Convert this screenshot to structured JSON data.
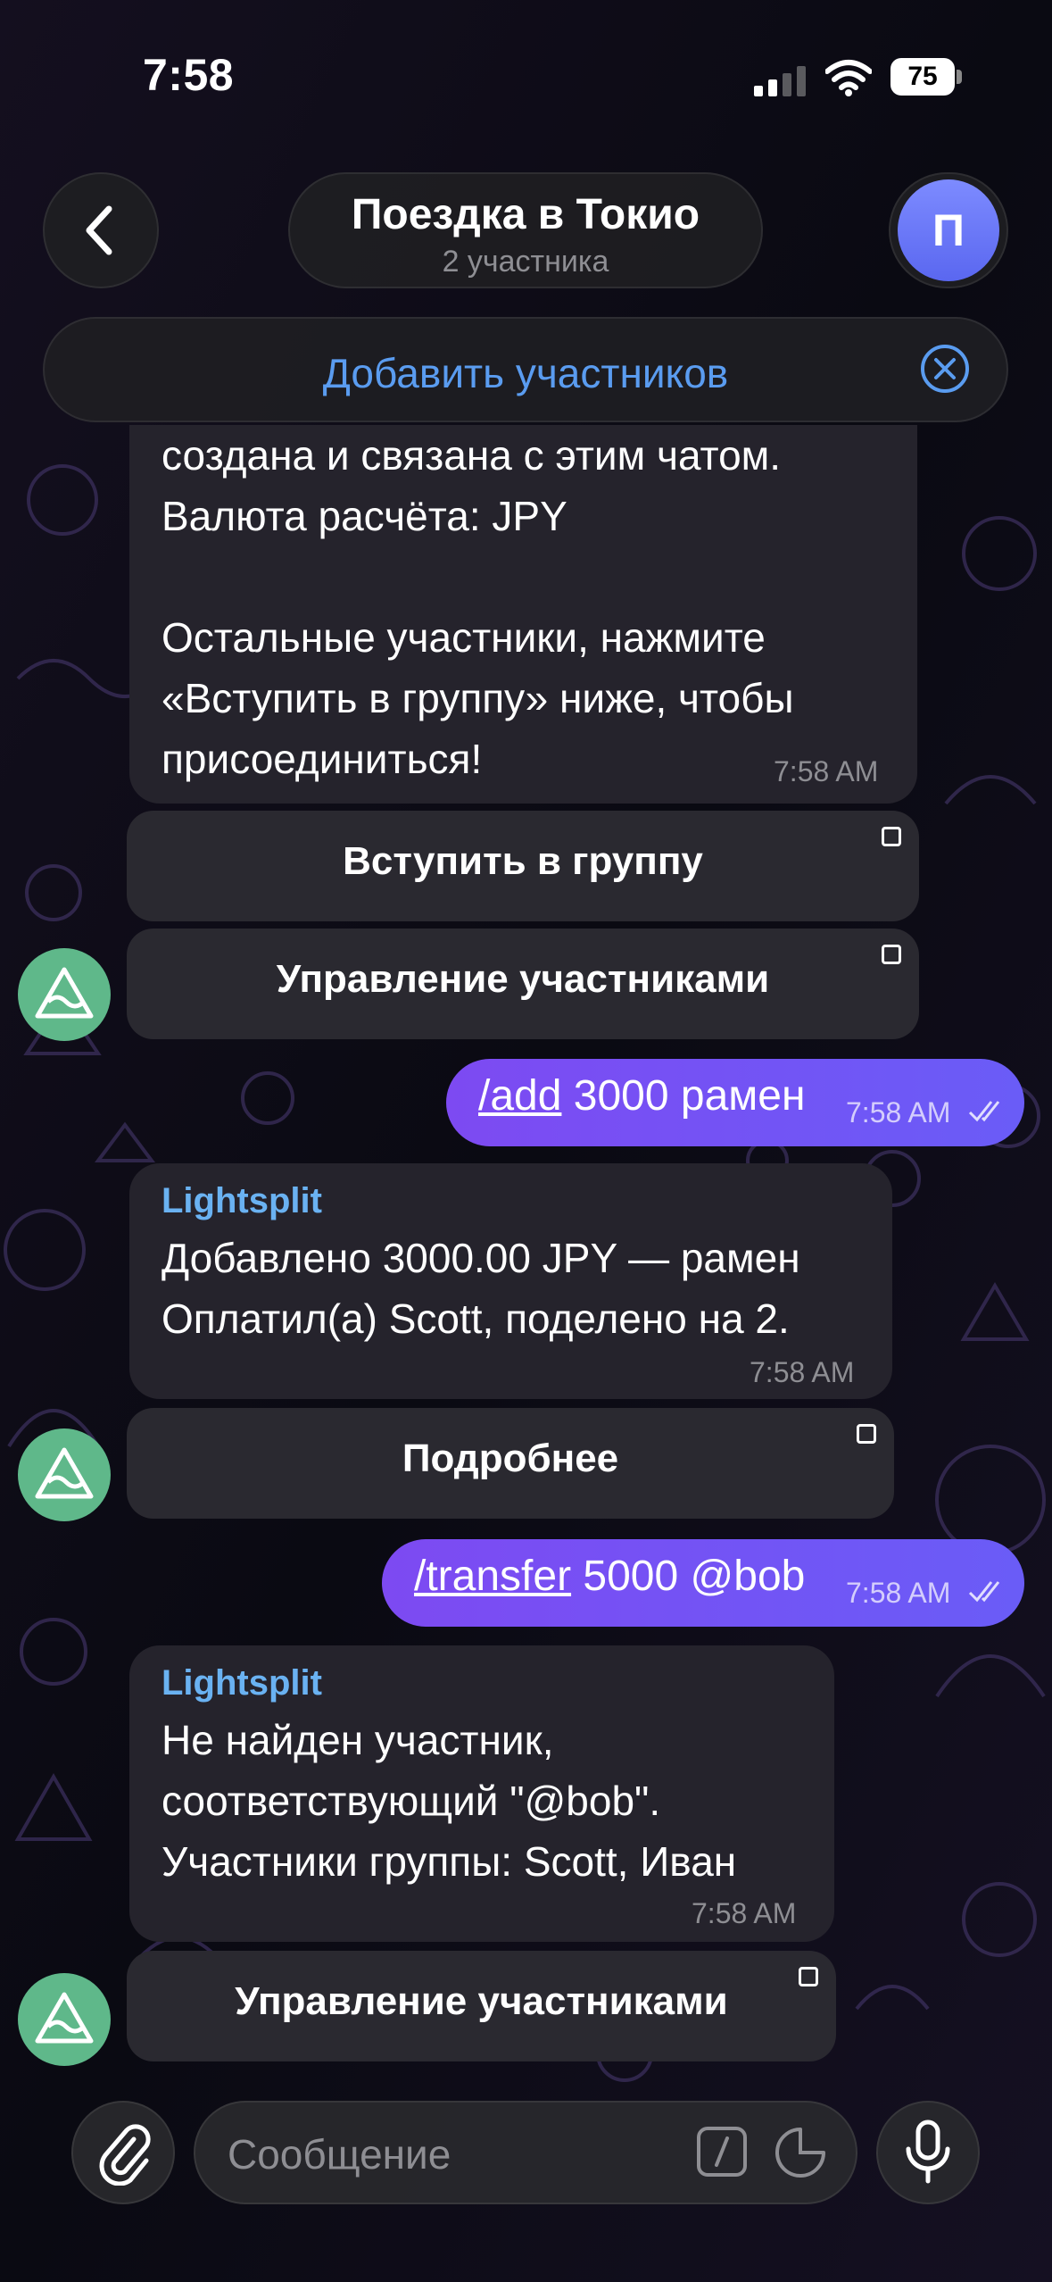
{
  "status_bar": {
    "time": "7:58",
    "battery": "75"
  },
  "header": {
    "title": "Поездка в Токио",
    "subtitle": "2 участника",
    "avatar_letter": "П"
  },
  "add_banner": {
    "label": "Добавить участников"
  },
  "messages": {
    "m1": {
      "lines": [
        "создана и связана с этим чатом.",
        "Валюта расчёта: JPY",
        "",
        "Остальные участники, нажмите",
        "«Вступить в группу» ниже, чтобы",
        "присоединиться!"
      ],
      "time": "7:58 AM",
      "buttons": [
        "Вступить в группу",
        "Управление участниками"
      ]
    },
    "m2": {
      "command": "/add",
      "text": " 3000 рамен",
      "time": "7:58 AM"
    },
    "m3": {
      "sender": "Lightsplit",
      "lines": [
        "Добавлено 3000.00 JPY — рамен",
        "Оплатил(а) Scott, поделено на 2."
      ],
      "time": "7:58 AM",
      "button": "Подробнее"
    },
    "m4": {
      "command": "/transfer",
      "text": " 5000 @bob",
      "time": "7:58 AM"
    },
    "m5": {
      "sender": "Lightsplit",
      "lines": [
        "Не найден участник,",
        "соответствующий \"@bob\".",
        "Участники группы: Scott, Иван"
      ],
      "time": "7:58 AM",
      "button": "Управление участниками"
    }
  },
  "input": {
    "placeholder": "Сообщение"
  },
  "icons": {
    "back": "chevron-left-icon",
    "close": "close-circle-icon",
    "attach": "paperclip-icon",
    "commands": "slash-command-icon",
    "sticker": "sticker-icon",
    "mic": "microphone-icon",
    "bot_avatar": "bot-avatar-icon"
  },
  "colors": {
    "accent": "#5a9cf0",
    "outgoing_bubble": "#7d4af2",
    "incoming_bubble": "#25232c",
    "sender_name": "#6ab2f2",
    "bot_avatar_bg": "#5fb88a"
  }
}
